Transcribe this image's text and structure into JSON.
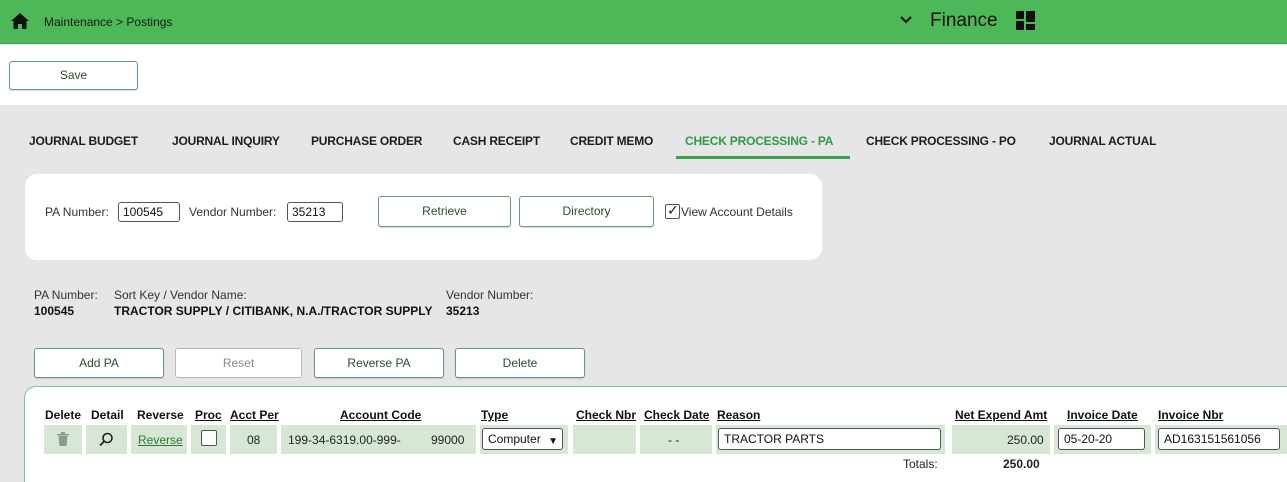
{
  "header": {
    "breadcrumb": "Maintenance > Postings",
    "app_name": "Finance",
    "icons": {
      "home": "home-icon",
      "chevron": "chevron-down-icon",
      "apps": "app-grid-icon"
    },
    "color": "#4cb857"
  },
  "toolbar": {
    "save_label": "Save"
  },
  "tabs": [
    {
      "label": "JOURNAL BUDGET"
    },
    {
      "label": "JOURNAL INQUIRY"
    },
    {
      "label": "PURCHASE ORDER"
    },
    {
      "label": "CASH RECEIPT"
    },
    {
      "label": "CREDIT MEMO"
    },
    {
      "label": "CHECK PROCESSING - PA",
      "active": true
    },
    {
      "label": "CHECK PROCESSING - PO"
    },
    {
      "label": "JOURNAL ACTUAL"
    }
  ],
  "criteria": {
    "pa_number_label": "PA Number:",
    "pa_number_value": "100545",
    "vendor_number_label": "Vendor Number:",
    "vendor_number_value": "35213",
    "retrieve_label": "Retrieve",
    "directory_label": "Directory",
    "view_details_label": "View Account Details",
    "view_details_checked": true
  },
  "info": {
    "pa_number_label": "PA Number:",
    "pa_number_value": "100545",
    "vendor_name_label": "Sort Key / Vendor Name:",
    "vendor_name_value": "TRACTOR SUPPLY / CITIBANK, N.A./TRACTOR SUPPLY",
    "vendor_number_label": "Vendor Number:",
    "vendor_number_value": "35213"
  },
  "actions": {
    "add_pa": "Add PA",
    "reset": "Reset",
    "reverse_pa": "Reverse PA",
    "delete": "Delete"
  },
  "grid": {
    "columns": {
      "delete": "Delete",
      "detail": "Detail",
      "reverse": "Reverse",
      "proc": "Proc",
      "acct_per": "Acct Per",
      "account_code": "Account Code",
      "type": "Type",
      "check_nbr": "Check Nbr",
      "check_date": "Check Date",
      "reason": "Reason",
      "net_expend_amt": "Net Expend Amt",
      "invoice_date": "Invoice Date",
      "invoice_nbr": "Invoice Nbr"
    },
    "row": {
      "reverse_link": "Reverse",
      "acct_per": "08",
      "account_code": "199-34-6319.00-999-",
      "account_code_suffix": "99000",
      "type": "Computer",
      "check_date": "- -",
      "reason": "TRACTOR PARTS",
      "net_expend_amt": "250.00",
      "invoice_date": "05-20-20",
      "invoice_nbr": "AD163151561056"
    },
    "totals_label": "Totals:",
    "totals_value": "250.00"
  }
}
